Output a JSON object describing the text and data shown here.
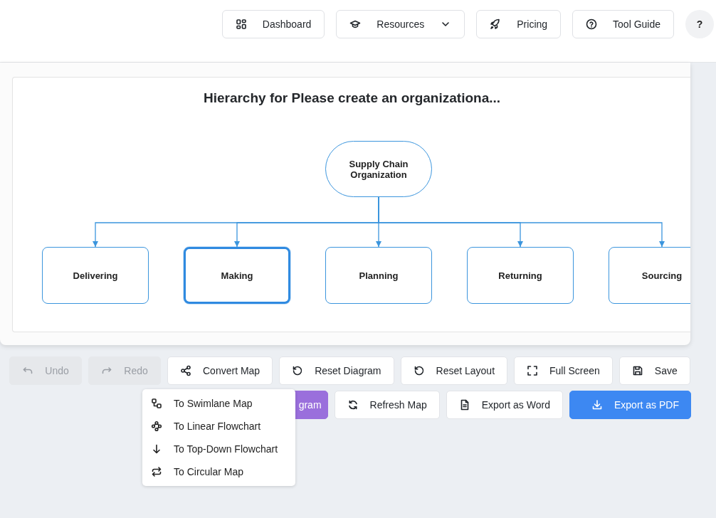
{
  "header": {
    "nav": [
      {
        "label": "Dashboard",
        "kind": "link"
      },
      {
        "label": "Resources",
        "kind": "dropdown"
      },
      {
        "label": "Pricing",
        "kind": "link"
      },
      {
        "label": "Tool Guide",
        "kind": "link"
      }
    ],
    "help": "?"
  },
  "diagram": {
    "title": "Hierarchy for Please create an organizationa...",
    "root": {
      "label": "Supply Chain Organization",
      "children": [
        {
          "label": "Delivering",
          "selected": false
        },
        {
          "label": "Making",
          "selected": true
        },
        {
          "label": "Planning",
          "selected": false
        },
        {
          "label": "Returning",
          "selected": false
        },
        {
          "label": "Sourcing",
          "selected": false
        }
      ]
    }
  },
  "toolbar_top": [
    {
      "label": "Undo",
      "disabled": true
    },
    {
      "label": "Redo",
      "disabled": true
    },
    {
      "label": "Convert Map",
      "disabled": false
    },
    {
      "label": "Reset Diagram",
      "disabled": false
    },
    {
      "label": "Reset Layout",
      "disabled": false
    },
    {
      "label": "Full Screen",
      "disabled": false
    },
    {
      "label": "Save",
      "disabled": false
    }
  ],
  "toolbar_bottom": [
    {
      "label": "gram",
      "kind": "accent"
    },
    {
      "label": "Refresh Map",
      "kind": "plain"
    },
    {
      "label": "Export as Word",
      "kind": "plain"
    },
    {
      "label": "Export as PDF",
      "kind": "primary"
    }
  ],
  "convert_menu": {
    "items": [
      {
        "label": "To Swimlane Map"
      },
      {
        "label": "To Linear Flowchart"
      },
      {
        "label": "To Top-Down Flowchart"
      },
      {
        "label": "To Circular Map"
      }
    ]
  }
}
